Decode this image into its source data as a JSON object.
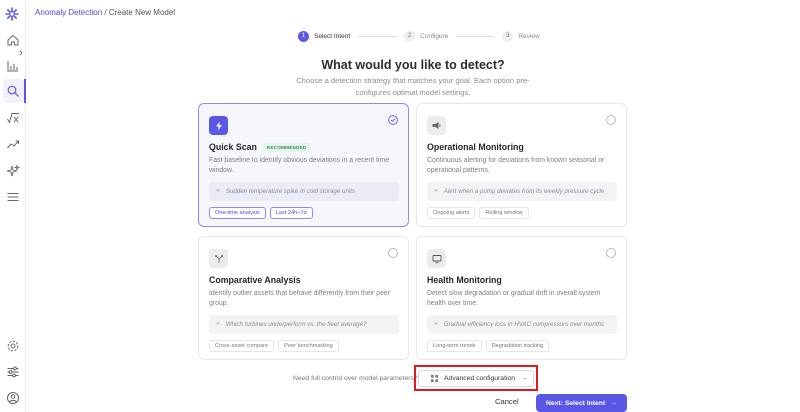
{
  "breadcrumb": {
    "parent": "Anomaly Detection",
    "separator": " / ",
    "current": "Create New Model"
  },
  "sidebar": {
    "items": [
      {
        "icon": "home-icon"
      },
      {
        "icon": "bar-chart-icon"
      },
      {
        "icon": "search-icon",
        "active": true
      },
      {
        "icon": "formula-icon"
      },
      {
        "icon": "trend-icon"
      },
      {
        "icon": "sparkle-icon"
      },
      {
        "icon": "menu-icon"
      }
    ],
    "bottom_items": [
      {
        "icon": "settings-icon"
      },
      {
        "icon": "sliders-icon"
      },
      {
        "icon": "user-icon"
      }
    ]
  },
  "stepper": [
    {
      "num": "1",
      "label": "Select Intent",
      "active": true
    },
    {
      "num": "2",
      "label": "Configure",
      "active": false
    },
    {
      "num": "3",
      "label": "Review",
      "active": false
    }
  ],
  "heading": {
    "title": "What would you like to detect?",
    "subtitle": "Choose a detection strategy that matches your goal. Each option pre-configures optimal model settings."
  },
  "cards": [
    {
      "name": "Quick Scan",
      "badge": "RECOMMENDED",
      "icon": "lightning-icon",
      "selected": true,
      "desc": "Fast baseline to identify obvious deviations in a recent time window.",
      "example": "Sudden temperature spike in cold storage units",
      "tags": [
        "One-time analysis",
        "Last 24h–7d"
      ]
    },
    {
      "name": "Operational Monitoring",
      "badge": "",
      "icon": "broadcast-icon",
      "selected": false,
      "desc": "Continuous alerting for deviations from known seasonal or operational patterns.",
      "example": "Alert when a pump deviates from its weekly pressure cycle",
      "tags": [
        "Ongoing alerts",
        "Rolling window"
      ]
    },
    {
      "name": "Comparative Analysis",
      "badge": "",
      "icon": "branch-icon",
      "selected": false,
      "desc": "Identify outlier assets that behave differently from their peer group.",
      "example": "Which turbines underperform vs. the fleet average?",
      "tags": [
        "Cross-asset compare",
        "Peer benchmarking"
      ]
    },
    {
      "name": "Health Monitoring",
      "badge": "",
      "icon": "monitor-icon",
      "selected": false,
      "desc": "Detect slow degradation or gradual drift in overall system health over time.",
      "example": "Gradual efficiency loss in HVAC compressors over months",
      "tags": [
        "Long-term trends",
        "Degradation tracking"
      ]
    }
  ],
  "footer": {
    "advanced_prompt": "Need full control over model parameters?",
    "advanced_button": "Advanced configuration",
    "cancel": "Cancel",
    "next": "Next: Select Intent",
    "next_arrow": "→",
    "adv_arrow": "→"
  },
  "colors": {
    "accent": "#5b57e6",
    "highlight": "#e01a1f",
    "badge_green": "#2f8a55"
  }
}
